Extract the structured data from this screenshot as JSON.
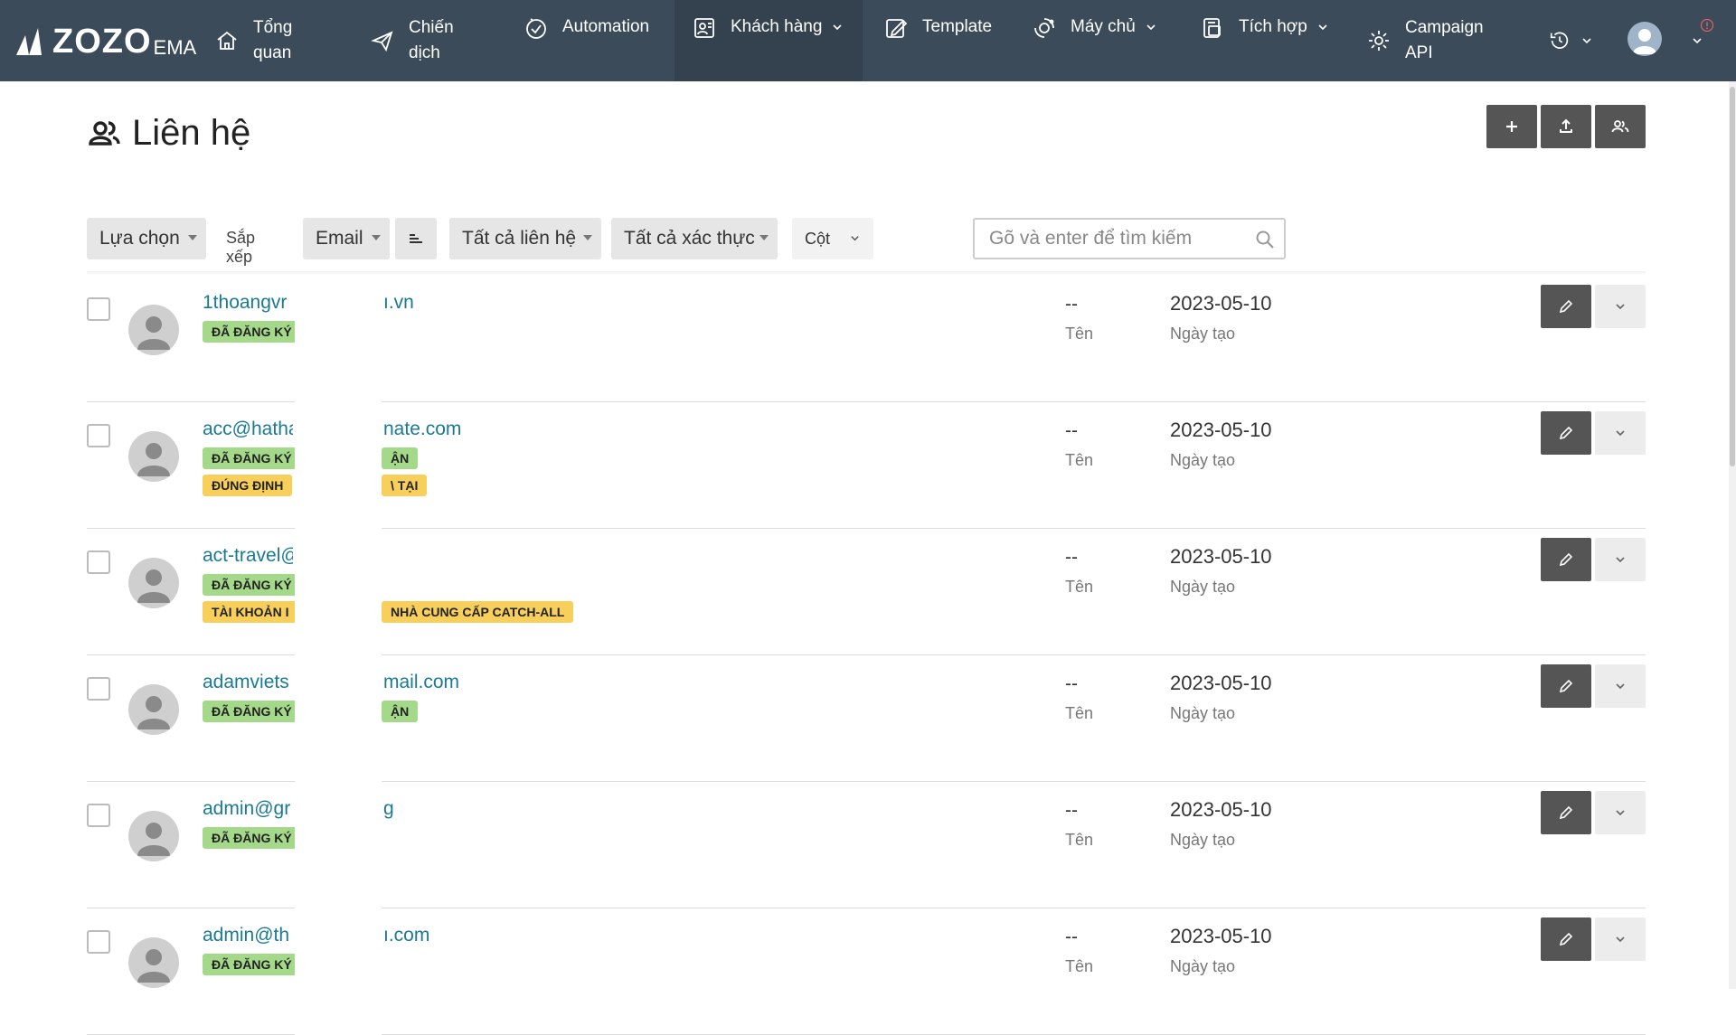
{
  "brand": {
    "name": "ZOZO",
    "suffix": "EMA"
  },
  "nav": [
    {
      "line1": "Tổng",
      "line2": "quan",
      "icon": "home-icon"
    },
    {
      "line1": "Chiến",
      "line2": "dịch",
      "icon": "send-icon"
    },
    {
      "line1": "Automation",
      "line2": "",
      "icon": "automation-icon"
    },
    {
      "line1": "Khách hàng",
      "line2": "",
      "icon": "customers-icon"
    },
    {
      "line1": "Template",
      "line2": "",
      "icon": "template-icon"
    },
    {
      "line1": "Máy chủ",
      "line2": "",
      "icon": "server-icon"
    },
    {
      "line1": "Tích hợp",
      "line2": "",
      "icon": "integration-icon"
    },
    {
      "line1": "Campaign",
      "line2": "API",
      "icon": "api-gear-icon"
    }
  ],
  "page": {
    "title": "Liên hệ"
  },
  "filters": {
    "select_label": "Lựa chọn",
    "sort_label": "Sắp xếp",
    "sort_field": "Email",
    "contacts_filter": "Tất cả liên hệ",
    "verify_filter": "Tất cả xác thực",
    "columns": "Cột",
    "search_placeholder": "Gõ và enter để tìm kiếm"
  },
  "columns": {
    "name_label": "Tên",
    "date_label": "Ngày tạo"
  },
  "contacts": [
    {
      "email_start": "1thoangvr",
      "email_end": "ı.vn",
      "name": "--",
      "created": "2023-05-10",
      "badges": [
        {
          "text": "ĐÃ ĐĂNG KÝ",
          "color": "green"
        }
      ],
      "badges_right": []
    },
    {
      "email_start": "acc@hatha",
      "email_end": "nate.com",
      "name": "--",
      "created": "2023-05-10",
      "badges": [
        {
          "text": "ĐÃ ĐĂNG KÝ",
          "color": "green"
        },
        {
          "text": "ĐÚNG ĐỊNH",
          "color": "yellow"
        }
      ],
      "badges_right": [
        {
          "text": "ẬN",
          "color": "green"
        },
        {
          "text": "\\ TẠI",
          "color": "yellow"
        }
      ]
    },
    {
      "email_start": "act-travel@",
      "email_end": "",
      "name": "--",
      "created": "2023-05-10",
      "badges": [
        {
          "text": "ĐÃ ĐĂNG KÝ",
          "color": "green"
        },
        {
          "text": "TÀI KHOẢN I",
          "color": "yellow"
        }
      ],
      "badges_right": [
        {
          "text": "",
          "color": "none"
        },
        {
          "text": "NHÀ CUNG CẤP CATCH-ALL",
          "color": "yellow"
        }
      ]
    },
    {
      "email_start": "adamviets",
      "email_end": "mail.com",
      "name": "--",
      "created": "2023-05-10",
      "badges": [
        {
          "text": "ĐÃ ĐĂNG KÝ",
          "color": "green"
        }
      ],
      "badges_right": [
        {
          "text": "ẬN",
          "color": "green"
        }
      ]
    },
    {
      "email_start": "admin@gr",
      "email_end": "g",
      "name": "--",
      "created": "2023-05-10",
      "badges": [
        {
          "text": "ĐÃ ĐĂNG KÝ",
          "color": "green"
        }
      ],
      "badges_right": []
    },
    {
      "email_start": "admin@th",
      "email_end": "ı.com",
      "name": "--",
      "created": "2023-05-10",
      "badges": [
        {
          "text": "ĐÃ ĐĂNG KÝ",
          "color": "green"
        }
      ],
      "badges_right": []
    }
  ]
}
